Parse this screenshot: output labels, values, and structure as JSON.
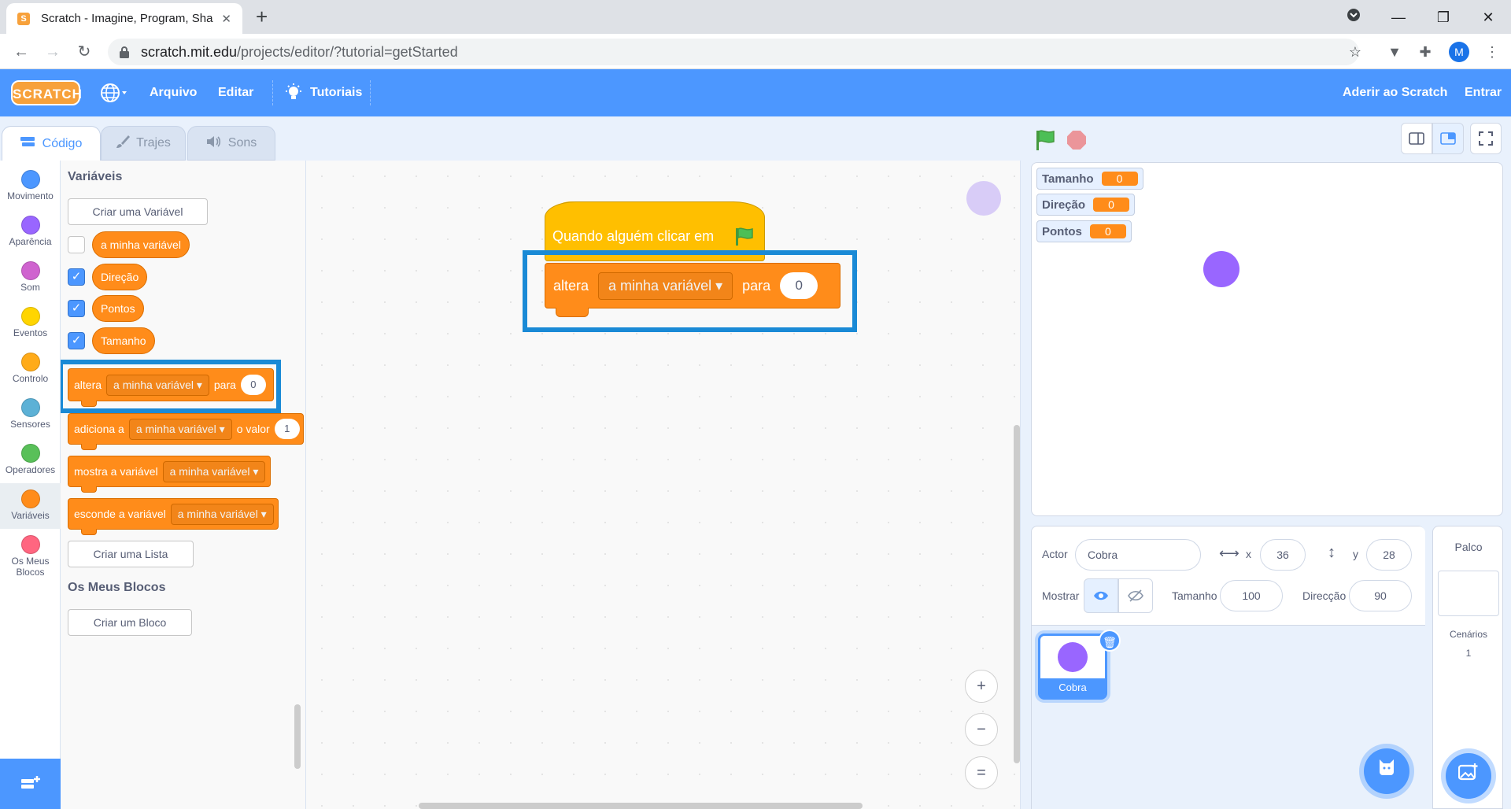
{
  "browser": {
    "tab_title": "Scratch - Imagine, Program, Share",
    "tab_close": "✕",
    "new_tab": "+",
    "url_host": "scratch.mit.edu",
    "url_path": "/projects/editor/?tutorial=getStarted",
    "profile_initial": "M"
  },
  "menubar": {
    "logo": "SCRATCH",
    "file": "Arquivo",
    "edit": "Editar",
    "tutorials": "Tutoriais",
    "join": "Aderir ao Scratch",
    "signin": "Entrar"
  },
  "tabs": {
    "code": "Código",
    "costumes": "Trajes",
    "sounds": "Sons"
  },
  "categories": [
    {
      "label": "Movimento",
      "color": "#4c97ff"
    },
    {
      "label": "Aparência",
      "color": "#9966ff"
    },
    {
      "label": "Som",
      "color": "#cf63cf"
    },
    {
      "label": "Eventos",
      "color": "#ffd500"
    },
    {
      "label": "Controlo",
      "color": "#ffab19"
    },
    {
      "label": "Sensores",
      "color": "#5cb1d6"
    },
    {
      "label": "Operadores",
      "color": "#59c059"
    },
    {
      "label": "Variáveis",
      "color": "#ff8c1a"
    },
    {
      "label": "Os Meus Blocos",
      "color": "#ff6680"
    }
  ],
  "palette": {
    "heading": "Variáveis",
    "make_variable": "Criar uma Variável",
    "variables": [
      {
        "name": "a minha variável",
        "checked": false
      },
      {
        "name": "Direção",
        "checked": true
      },
      {
        "name": "Pontos",
        "checked": true
      },
      {
        "name": "Tamanho",
        "checked": true
      }
    ],
    "set_block": {
      "word1": "altera",
      "var": "a minha variável",
      "word2": "para",
      "value": "0"
    },
    "change_block": {
      "word1": "adiciona a",
      "var": "a minha variável",
      "word2": "o valor",
      "value": "1"
    },
    "show_block": {
      "word1": "mostra a variável",
      "var": "a minha variável"
    },
    "hide_block": {
      "word1": "esconde a variável",
      "var": "a minha variável"
    },
    "make_list": "Criar uma Lista",
    "my_blocks_heading": "Os Meus Blocos",
    "make_block": "Criar um Bloco"
  },
  "workspace": {
    "hat_label": "Quando alguém clicar em",
    "set_word1": "altera",
    "set_var": "a minha variável",
    "set_word2": "para",
    "set_value": "0",
    "zoom_in": "+",
    "zoom_out": "−",
    "zoom_reset": "="
  },
  "stage": {
    "monitors": [
      {
        "name": "Tamanho",
        "value": "0"
      },
      {
        "name": "Direção",
        "value": "0"
      },
      {
        "name": "Pontos",
        "value": "0"
      }
    ]
  },
  "sprite_info": {
    "sprite_label": "Actor",
    "sprite_name": "Cobra",
    "x_label": "x",
    "x_value": "36",
    "y_label": "y",
    "y_value": "28",
    "show_label": "Mostrar",
    "size_label": "Tamanho",
    "size_value": "100",
    "direction_label": "Direcção",
    "direction_value": "90",
    "sprite_tile_name": "Cobra"
  },
  "stage_target": {
    "title": "Palco",
    "backdrops_label": "Cenários",
    "backdrops_count": "1"
  },
  "colors": {
    "menubar": "#4c97ff",
    "variables": "#ff8c1a",
    "events": "#ffbf00",
    "highlight": "#1a8ad6",
    "sprite": "#9966ff"
  }
}
